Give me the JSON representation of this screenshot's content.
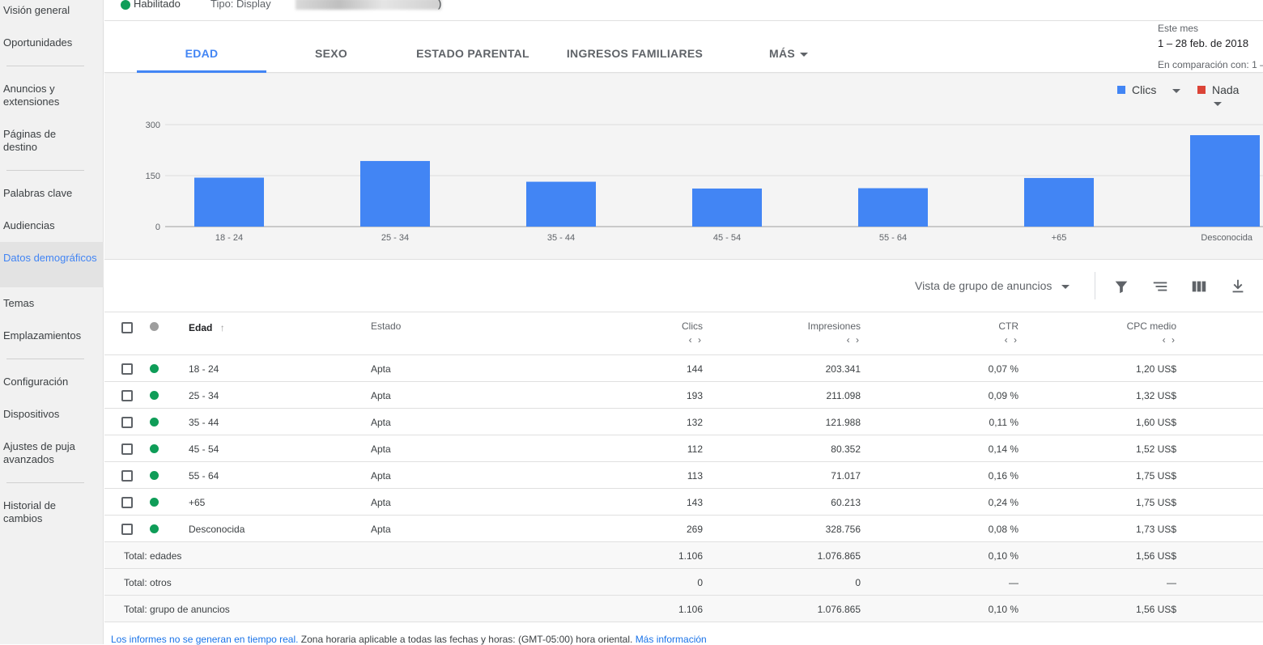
{
  "sidebar": {
    "items": [
      {
        "label": "Visión general"
      },
      {
        "label": "Oportunidades"
      },
      {
        "label": "Anuncios y extensiones"
      },
      {
        "label": "Páginas de destino"
      },
      {
        "label": "Palabras clave"
      },
      {
        "label": "Audiencias"
      },
      {
        "label": "Datos demográficos"
      },
      {
        "label": "Temas"
      },
      {
        "label": "Emplazamientos"
      },
      {
        "label": "Configuración"
      },
      {
        "label": "Dispositivos"
      },
      {
        "label": "Ajustes de puja avanzados"
      },
      {
        "label": "Historial de cambios"
      }
    ]
  },
  "header": {
    "status": "Habilitado",
    "type": "Tipo: Display",
    "redacted_suffix": ")"
  },
  "tabs": {
    "items": [
      {
        "label": "EDAD"
      },
      {
        "label": "SEXO"
      },
      {
        "label": "ESTADO PARENTAL"
      },
      {
        "label": "INGRESOS FAMILIARES"
      },
      {
        "label": "MÁS"
      }
    ]
  },
  "date": {
    "label": "Este mes",
    "range": "1 – 28 feb. de 2018",
    "compare": "En comparación con: 1 –"
  },
  "metrics": {
    "primary": {
      "label": "Clics",
      "color": "#4285f4"
    },
    "secondary": {
      "label": "Nada",
      "color": "#db4437"
    }
  },
  "chart_data": {
    "type": "bar",
    "categories": [
      "18 - 24",
      "25 - 34",
      "35 - 44",
      "45 - 54",
      "55 - 64",
      "+65",
      "Desconocida"
    ],
    "series": [
      {
        "name": "Clics",
        "values": [
          144,
          193,
          132,
          112,
          113,
          143,
          269
        ]
      }
    ],
    "yticks": [
      "0",
      "150",
      "300"
    ],
    "ylim": [
      0,
      300
    ],
    "grid": true,
    "bar_color": "#4285f4"
  },
  "toolbar": {
    "view": "Vista de grupo de anuncios",
    "icons": [
      "filter-icon",
      "segment-icon",
      "columns-icon",
      "download-icon"
    ]
  },
  "table": {
    "headers": {
      "edad": "Edad",
      "estado": "Estado",
      "clics": "Clics",
      "impresiones": "Impresiones",
      "ctr": "CTR",
      "cpc": "CPC medio",
      "sort_arrows": "‹ ›"
    },
    "rows": [
      {
        "edad": "18 - 24",
        "estado": "Apta",
        "clics": "144",
        "impresiones": "203.341",
        "ctr": "0,07 %",
        "cpc": "1,20 US$"
      },
      {
        "edad": "25 - 34",
        "estado": "Apta",
        "clics": "193",
        "impresiones": "211.098",
        "ctr": "0,09 %",
        "cpc": "1,32 US$"
      },
      {
        "edad": "35 - 44",
        "estado": "Apta",
        "clics": "132",
        "impresiones": "121.988",
        "ctr": "0,11 %",
        "cpc": "1,60 US$"
      },
      {
        "edad": "45 - 54",
        "estado": "Apta",
        "clics": "112",
        "impresiones": "80.352",
        "ctr": "0,14 %",
        "cpc": "1,52 US$"
      },
      {
        "edad": "55 - 64",
        "estado": "Apta",
        "clics": "113",
        "impresiones": "71.017",
        "ctr": "0,16 %",
        "cpc": "1,75 US$"
      },
      {
        "edad": "+65",
        "estado": "Apta",
        "clics": "143",
        "impresiones": "60.213",
        "ctr": "0,24 %",
        "cpc": "1,75 US$"
      },
      {
        "edad": "Desconocida",
        "estado": "Apta",
        "clics": "269",
        "impresiones": "328.756",
        "ctr": "0,08 %",
        "cpc": "1,73 US$"
      }
    ],
    "totals": [
      {
        "label": "Total: edades",
        "clics": "1.106",
        "impresiones": "1.076.865",
        "ctr": "0,10 %",
        "cpc": "1,56 US$"
      },
      {
        "label": "Total: otros",
        "clics": "0",
        "impresiones": "0",
        "ctr": "—",
        "cpc": "—"
      },
      {
        "label": "Total: grupo de anuncios",
        "clics": "1.106",
        "impresiones": "1.076.865",
        "ctr": "0,10 %",
        "cpc": "1,56 US$"
      }
    ]
  },
  "footer": {
    "link1": "Los informes no se generan en tiempo real.",
    "text": " Zona horaria aplicable a todas las fechas y horas: (GMT-05:00) hora oriental. ",
    "link2": "Más información"
  }
}
